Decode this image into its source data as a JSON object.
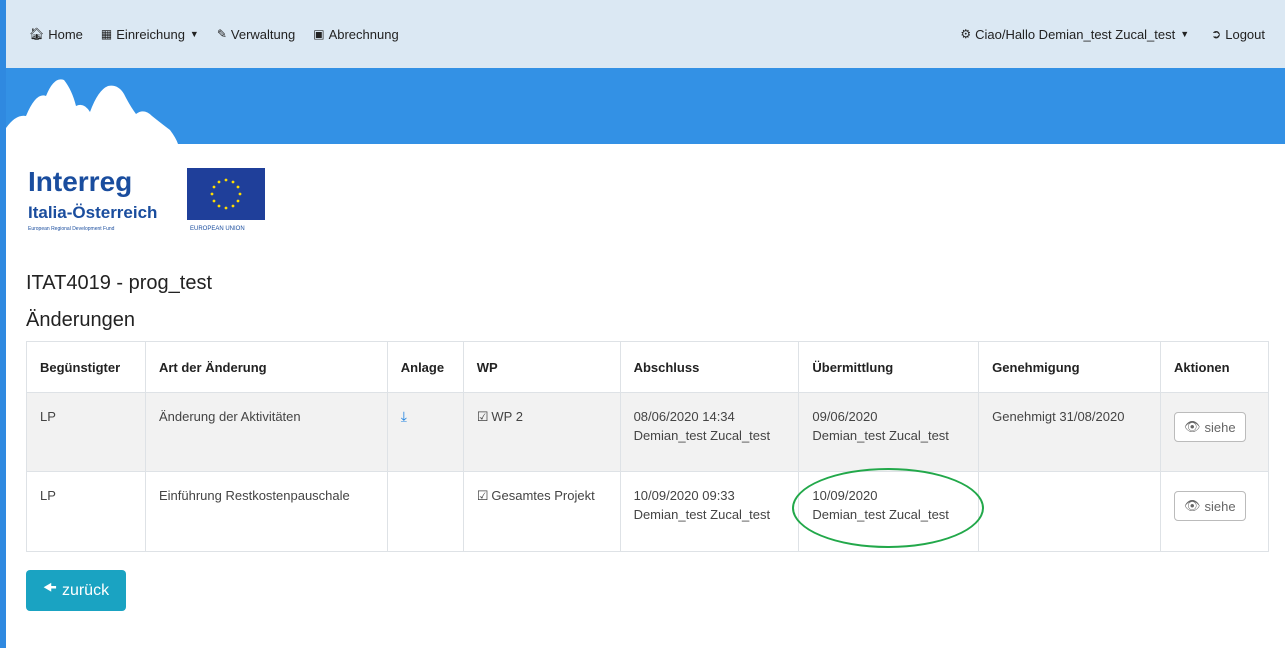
{
  "nav": {
    "home": "Home",
    "einreichung": "Einreichung",
    "verwaltung": "Verwaltung",
    "abrechnung": "Abrechnung",
    "user": "Ciao/Hallo Demian_test Zucal_test",
    "logout": "Logout"
  },
  "logo": {
    "brand": "Interreg",
    "program": "Italia-Österreich",
    "fund": "European Regional Development Fund",
    "eu": "EUROPEAN UNION"
  },
  "page": {
    "title": "ITAT4019 - prog_test",
    "section": "Änderungen"
  },
  "table": {
    "headers": [
      "Begünstigter",
      "Art der Änderung",
      "Anlage",
      "WP",
      "Abschluss",
      "Übermittlung",
      "Genehmigung",
      "Aktionen"
    ],
    "rows": [
      {
        "beneficiary": "LP",
        "type": "Änderung der Aktivitäten",
        "wp": "WP 2",
        "abschluss_date": "08/06/2020 14:34",
        "abschluss_user": "Demian_test Zucal_test",
        "uebermittlung_date": "09/06/2020",
        "uebermittlung_user": "Demian_test Zucal_test",
        "genehmigung": "Genehmigt 31/08/2020",
        "action": "siehe"
      },
      {
        "beneficiary": "LP",
        "type": "Einführung Restkostenpauschale",
        "wp": "Gesamtes Projekt",
        "abschluss_date": "10/09/2020 09:33",
        "abschluss_user": "Demian_test Zucal_test",
        "uebermittlung_date": "10/09/2020",
        "uebermittlung_user": "Demian_test Zucal_test",
        "genehmigung": "",
        "action": "siehe"
      }
    ]
  },
  "back_button": "zurück",
  "colors": {
    "nav_bg": "#dbe8f3",
    "banner_blue": "#3391e5",
    "back_button": "#1aa3c2",
    "highlight_green": "#22a84a",
    "interreg_blue": "#1a4d9e"
  }
}
